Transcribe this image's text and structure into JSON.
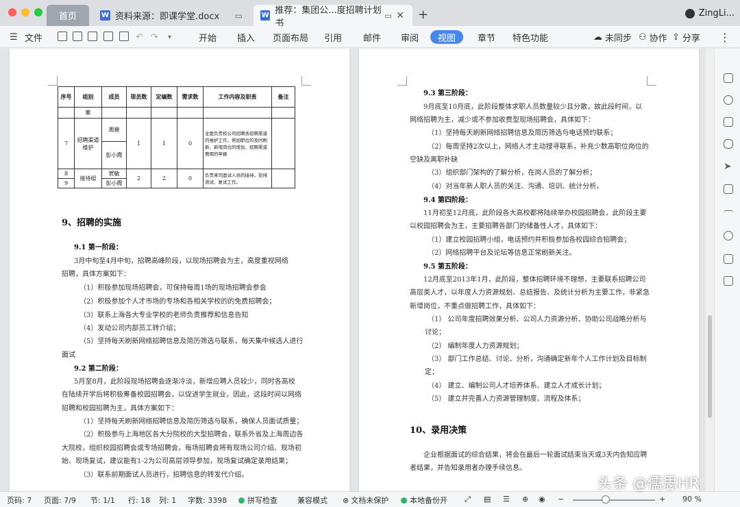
{
  "titlebar": {
    "tabs": [
      {
        "label": "首页"
      },
      {
        "label": "资料来源：即课学堂.docx"
      },
      {
        "label": "推荐：集团公...度招聘计划书"
      }
    ],
    "user": "ZingLi..."
  },
  "toolbar": {
    "file": "文件",
    "menus": [
      "开始",
      "插入",
      "页面布局",
      "引用",
      "邮件",
      "审阅",
      "视图",
      "章节",
      "特色功能"
    ],
    "active_menu": "视图",
    "sync": "未同步",
    "collab": "协作",
    "share": "分享"
  },
  "table": {
    "headers": [
      "序号",
      "组别",
      "成员",
      "现员数",
      "定编数",
      "需求数",
      "工作内容及职责",
      "备注"
    ],
    "row_top": "案",
    "row7": {
      "no": "7",
      "group": "招聘渠道维护",
      "members": [
        "周裴",
        "彭小霞"
      ],
      "current": "1",
      "quota": "1",
      "need": "0",
      "duty": "全面负责校公司招聘各招聘渠道的维护工作，例如职位的及时刷新、新增岗位的增加、招聘渠道费用的申报"
    },
    "row89": {
      "no": [
        "8",
        "9"
      ],
      "group": "接待组",
      "members": [
        "贺敏",
        "彭小霞"
      ],
      "current": "2",
      "quota": "2",
      "need": "0",
      "duty": "负责来司面试人员的接待，安排测试、复试工作。"
    }
  },
  "left_page": {
    "section9": "9、招聘的实施",
    "s91_title": "9.1 第一阶段：",
    "s91_intro1": "3月中旬至4月中旬，招聘高峰阶段，以现场招聘会为主，高度重视网络",
    "s91_intro2": "招聘，具体方案如下：",
    "s91_items": [
      "（1）积极参加现场招聘会，可保持每周1场的现场招聘会参会",
      "（2）积极参加个人才市场的专场和各相关学校的的免费招聘会；",
      "（3）联系上海各大专业学校的老师负责推荐和信息告知",
      "（4）发动公司内部员工转介绍；",
      "（5）坚持每天刷新网络招聘信息及简历筛选与联系，每天集中候选人进行"
    ],
    "s91_tail": "面试",
    "s92_title": "9.2  第二阶段：",
    "s92_intro": [
      "5月至8月，此阶段现场招聘会逐渐冷淡，新增应聘人员较少，同时各高校",
      "在陆续开学后将积极筹备校园招聘会，以促进学生就业，因此，这段时间以网络",
      "招聘和校园招聘为主，具体方案如下："
    ],
    "s92_items": [
      "（1）坚持每天刷新网络招聘信息及简历筛选与联系，确保人员面试质量；",
      "（2）积极参与上海地区各大分院校的大型招聘会，联系外省及上海周边各"
    ],
    "s92_more": [
      "大院校，组织校园招聘会或专场招聘会，每场招聘会将有现场公司介绍、现场初",
      "始、现场复试，建议能有1-2为公司高层领导参加，现场复试确定录用结果；"
    ],
    "s92_item3": "（3）联系前期面试人员进行，招聘信息的转发代介绍。"
  },
  "right_page": {
    "s93_title": "9.3  第三阶段：",
    "s93_intro": [
      "9月底至10月底，此阶段整体求职人员数量较少且分散，故此段时间，以",
      "网络招聘为主，减少或不参加收费型现场招聘会，具体如下："
    ],
    "s93_items": [
      "（1）坚持每天刷新网络招聘信息及简历筛选与电话预约联系；",
      "（2）每周坚持2次以上，网络人才主动搜寻联系，补充少数高职位岗位的"
    ],
    "s93_more": "空缺及离职补缺",
    "s93_items2": [
      "（3）组织部门架构的了解分析，在岗人员的了解分析；",
      "（4）对当年新人职人员的关注、沟通、培训、统计分析。"
    ],
    "s94_title": "9.4 第四阶段：",
    "s94_intro": [
      "11月初至12月底，此阶段各大高校都将陆续举办校园招聘会，此阶段主要",
      "以校园招聘会为主，主要招聘各部门的储备性人才，具体如下："
    ],
    "s94_items": [
      "（1）建立校园招聘小组，电话预约并积极参加各校园综合招聘会；",
      "（2）网络招聘平台及论坛等信息正常刷新关注。"
    ],
    "s95_title": "9.5 第五阶段：",
    "s95_intro": [
      "12月底至2013年1月，此阶段，整体招聘环境不理想，主要联系招聘公司",
      "高层类人才，以年度人力资源规划、总结报告、及统计分析为主要工作，非紧急",
      "新增岗位，不重点做招聘工作，具体如下："
    ],
    "s95_items": [
      "（1）   公司年度招聘效果分析、公司人力资源分析、协助公司战略分析与",
      "讨论；",
      "（2）   编制年度人力资源规划；",
      "（3）   部门工作总结、讨论、分析，沟通确定新年个人工作计划及目标制",
      "定；",
      "（4）   建立、编制公司人才培养体系、建立人才成长计划；",
      "（5）   建立并完善人力资源管理制度、流程及体系；"
    ],
    "section10": "10、录用决策",
    "s10_text": [
      "企业根据面试的综合结果，将会在最后一轮面试结束当天或3天内告知应聘",
      "者结果，并告知录用者办理手续信息。"
    ]
  },
  "statusbar": {
    "page_code": "页码: 7",
    "page": "页面: 7/9",
    "section": "节: 1/1",
    "row": "行: 18",
    "col": "列: 1",
    "words": "字数: 3398",
    "spell": "拼写检查",
    "compat": "兼容模式",
    "protect": "文档未保护",
    "backup": "本地备份开",
    "zoom": "90 %"
  },
  "watermark": "头条 @儒思HR"
}
